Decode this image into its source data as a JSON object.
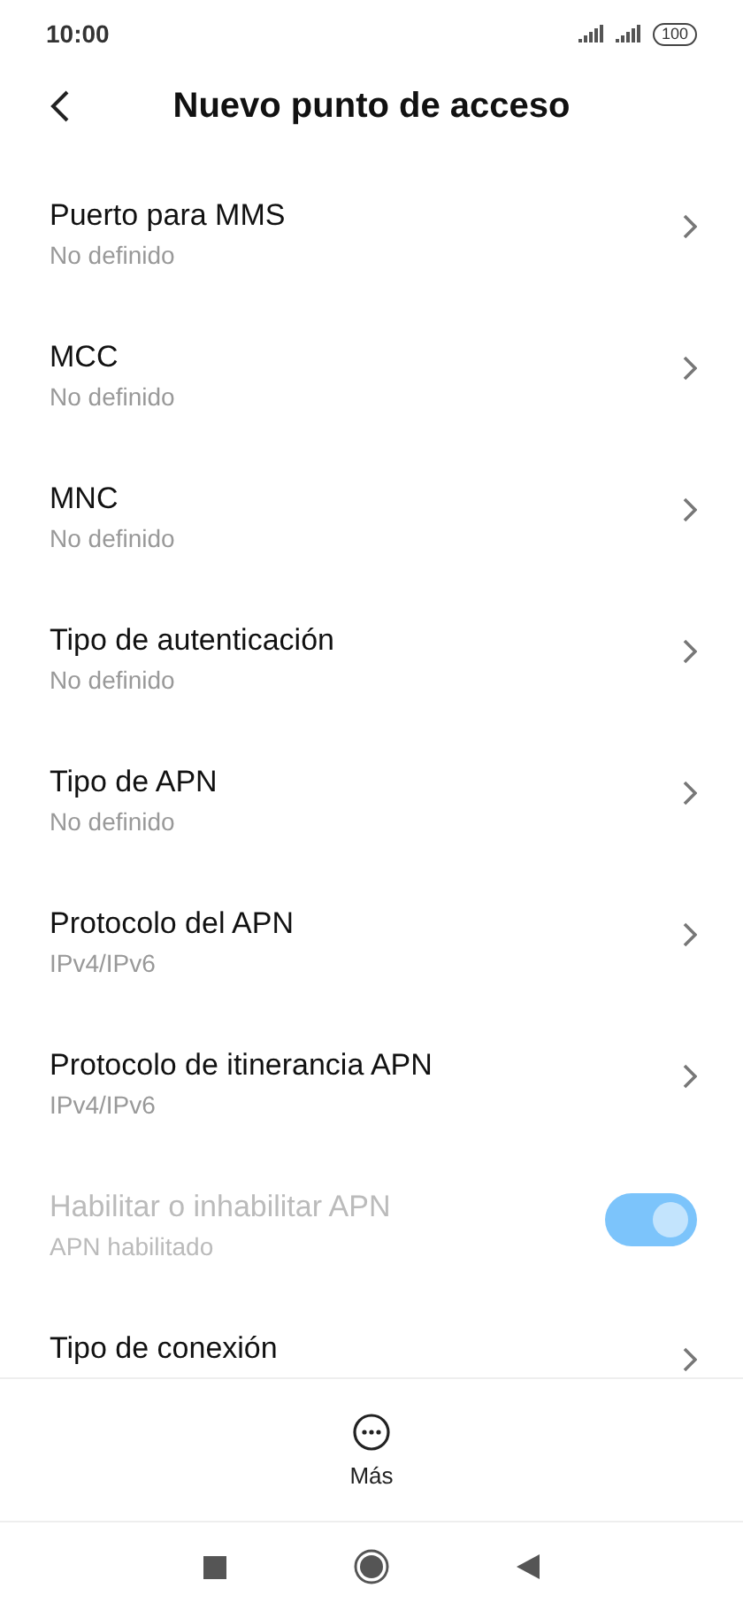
{
  "status_bar": {
    "time": "10:00",
    "battery": "100"
  },
  "header": {
    "title": "Nuevo punto de acceso"
  },
  "items": [
    {
      "kind": "link",
      "title": "Puerto para MMS",
      "subtitle": "No definido",
      "disabled": false
    },
    {
      "kind": "link",
      "title": "MCC",
      "subtitle": "No definido",
      "disabled": false
    },
    {
      "kind": "link",
      "title": "MNC",
      "subtitle": "No definido",
      "disabled": false
    },
    {
      "kind": "link",
      "title": "Tipo de autenticación",
      "subtitle": "No definido",
      "disabled": false
    },
    {
      "kind": "link",
      "title": "Tipo de APN",
      "subtitle": "No definido",
      "disabled": false
    },
    {
      "kind": "link",
      "title": "Protocolo del APN",
      "subtitle": "IPv4/IPv6",
      "disabled": false
    },
    {
      "kind": "link",
      "title": "Protocolo de itinerancia APN",
      "subtitle": "IPv4/IPv6",
      "disabled": false
    },
    {
      "kind": "toggle",
      "title": "Habilitar o inhabilitar APN",
      "subtitle": "APN habilitado",
      "disabled": true,
      "on": true
    },
    {
      "kind": "link",
      "title": "Tipo de conexión",
      "disabled": false
    }
  ],
  "bottom_bar": {
    "label": "Más"
  }
}
